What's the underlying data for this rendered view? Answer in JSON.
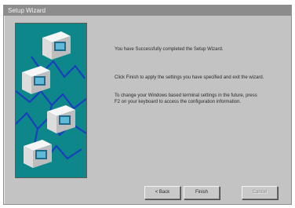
{
  "window": {
    "title": "Setup Wizard"
  },
  "body": {
    "line1": "You have Successfully completed the Setup Wizard.",
    "line2": "Click Finish to apply the settings you have specified and exit the wizard.",
    "line3": "To change your Windows based terminal settings in the future, press F2 on your keyboard to access the configuration information."
  },
  "buttons": {
    "back": "< Back",
    "finish": "Finish",
    "cancel": "Cancel"
  },
  "icons": {
    "network_image": "network-computers-illustration"
  },
  "colors": {
    "banner_bg": "#0d8789",
    "cable": "#1a3fbd",
    "window_bg": "#c3c3c3",
    "titlebar_bg": "#8c8c8c"
  }
}
